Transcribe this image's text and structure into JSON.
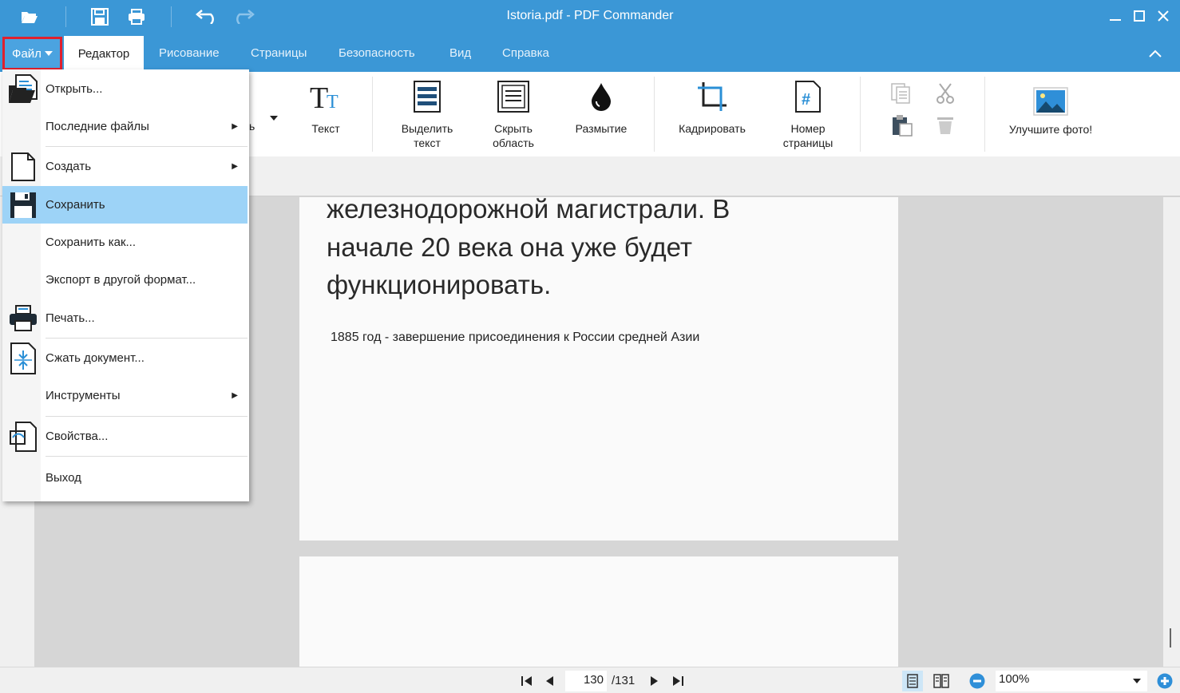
{
  "window": {
    "title": "Istoria.pdf - PDF Commander"
  },
  "tabs": {
    "file": "Файл",
    "editor": "Редактор",
    "drawing": "Рисование",
    "pages": "Страницы",
    "security": "Безопасность",
    "view": "Вид",
    "help": "Справка"
  },
  "ribbon": {
    "partial_label": "ь",
    "text": "Текст",
    "highlight_l1": "Выделить",
    "highlight_l2": "текст",
    "hide_l1": "Скрыть",
    "hide_l2": "область",
    "blur": "Размытие",
    "crop": "Кадрировать",
    "pagenum_l1": "Номер",
    "pagenum_l2": "страницы",
    "improve": "Улучшите фото!"
  },
  "document": {
    "line1": "железнодорожной магистрали. В",
    "line2": "начале 20 века она уже будет",
    "line3": "функционировать.",
    "small": "1885 год - завершение присоединения к России средней Азии"
  },
  "status": {
    "page_current": "130",
    "page_total": "/131",
    "zoom": "100%"
  },
  "file_menu": {
    "open": "Открыть...",
    "recent": "Последние файлы",
    "create": "Создать",
    "save": "Сохранить",
    "save_as": "Сохранить как...",
    "export": "Экспорт в другой формат...",
    "print": "Печать...",
    "compress": "Сжать документ...",
    "tools": "Инструменты",
    "properties": "Свойства...",
    "exit": "Выход"
  },
  "colors": {
    "accent": "#3b97d6",
    "menu_highlight": "#9dd3f7",
    "file_tab_outline": "#e0202e"
  }
}
